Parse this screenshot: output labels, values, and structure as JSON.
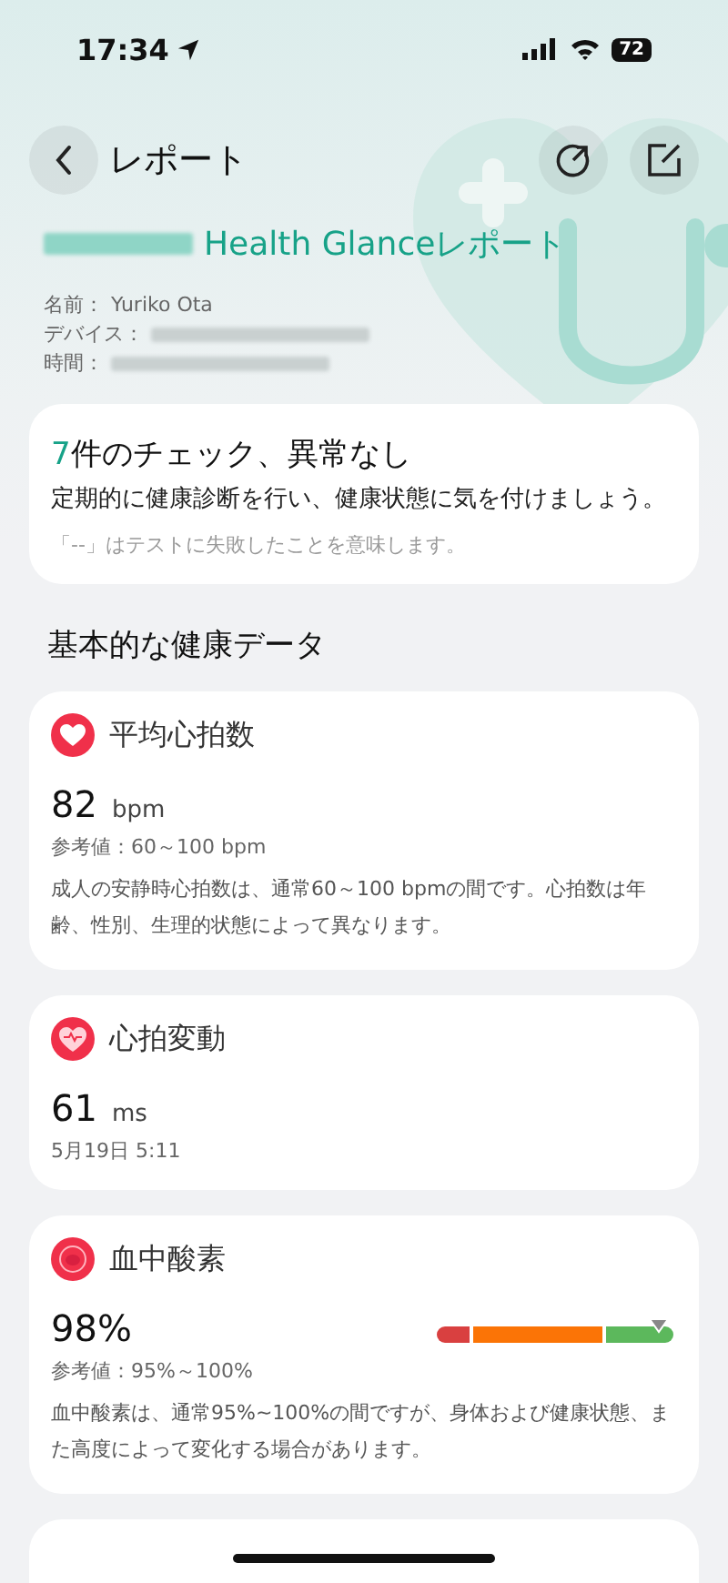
{
  "status_bar": {
    "time": "17:34",
    "battery": "72"
  },
  "header": {
    "title": "レポート"
  },
  "report": {
    "title": "Health Glanceレポート",
    "info": [
      {
        "label": "名前：",
        "value": "Yuriko Ota"
      },
      {
        "label": "デバイス："
      },
      {
        "label": "時間："
      }
    ]
  },
  "summary": {
    "count": "7",
    "headline": "件のチェック、異常なし",
    "advice": "定期的に健康診断を行い、健康状態に気を付けましょう。",
    "note": "「--」はテストに失敗したことを意味します。"
  },
  "section_title": "基本的な健康データ",
  "metrics": [
    {
      "kind": "heart_rate",
      "title": "平均心拍数",
      "value": "82",
      "unit": "bpm",
      "reference": "参考値：60～100 bpm",
      "description": "成人の安静時心拍数は、通常60～100 bpmの間です。心拍数は年齢、性別、生理的状態によって異なります。"
    },
    {
      "kind": "hrv",
      "title": "心拍変動",
      "value": "61",
      "unit": "ms",
      "date": "5月19日 5:11"
    },
    {
      "kind": "blood_oxygen",
      "title": "血中酸素",
      "value": "98%",
      "level": 0.94,
      "reference": "参考値：95%～100%",
      "description": "血中酸素は、通常95%~100%の間ですが、身体および健康状態、また高度によって変化する場合があります。"
    }
  ]
}
